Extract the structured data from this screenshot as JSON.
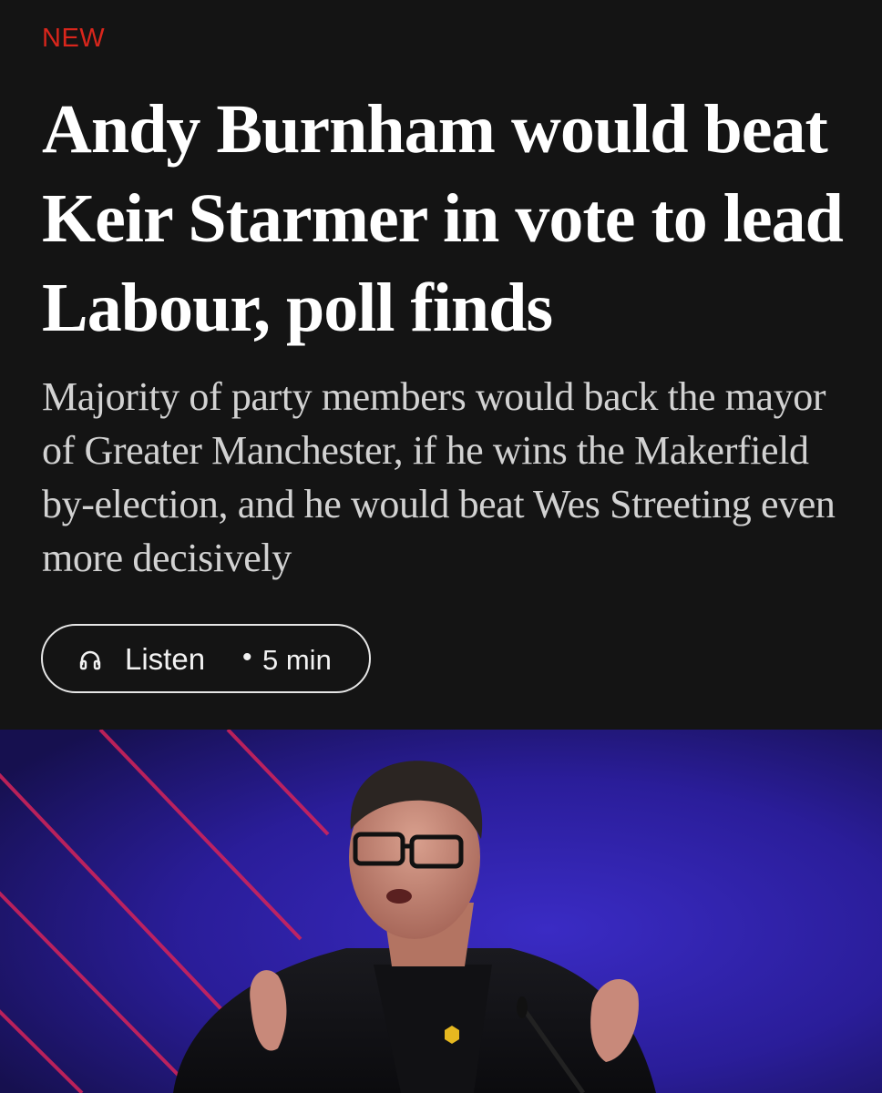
{
  "article": {
    "tag": "NEW",
    "headline": "Andy Burnham would beat Keir Starmer in vote to lead Labour, poll finds",
    "standfirst": "Majority of party members would back the mayor of Greater Manchester, if he wins the Makerfield by-election, and he would beat Wes Streeting even more decisively"
  },
  "listen": {
    "icon": "headphones-icon",
    "label": "Listen",
    "separator": "•",
    "duration": "5 min"
  },
  "colors": {
    "background": "#141414",
    "tag": "#d9261c",
    "headline": "#ffffff",
    "standfirst": "#d2d2d2",
    "hero_background": "#2a1d8c",
    "hero_stripes": "#d6245a"
  }
}
